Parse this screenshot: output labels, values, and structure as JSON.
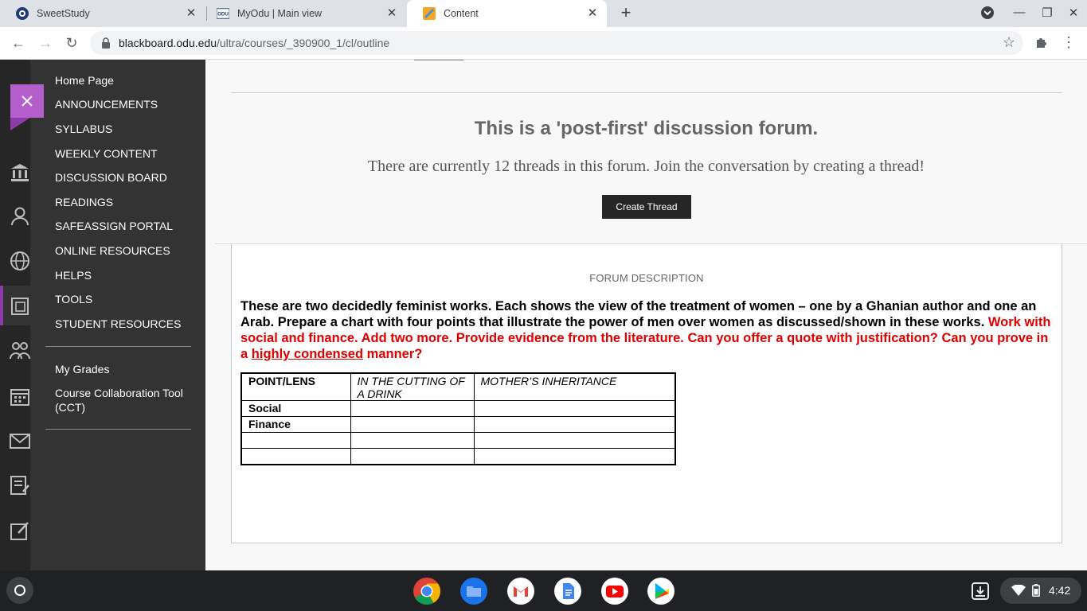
{
  "browser": {
    "tabs": [
      {
        "title": "SweetStudy",
        "favicon": "sweetstudy-logo-icon",
        "active": false
      },
      {
        "title": "MyOdu | Main view",
        "favicon": "odu-logo-icon",
        "active": false
      },
      {
        "title": "Content",
        "favicon": "blackboard-content-icon",
        "active": true
      }
    ],
    "url_host": "blackboard.odu.edu",
    "url_path": "/ultra/courses/_390900_1/cl/outline"
  },
  "course_menu": {
    "items": [
      {
        "label": "Home Page"
      },
      {
        "label": "ANNOUNCEMENTS"
      },
      {
        "label": "SYLLABUS"
      },
      {
        "label": "WEEKLY CONTENT"
      },
      {
        "label": "DISCUSSION BOARD"
      },
      {
        "label": "READINGS"
      },
      {
        "label": "SAFEASSIGN PORTAL"
      },
      {
        "label": "ONLINE RESOURCES"
      },
      {
        "label": "HELPS"
      },
      {
        "label": "TOOLS"
      },
      {
        "label": "STUDENT RESOURCES"
      }
    ],
    "secondary_items": [
      {
        "label": "My Grades"
      },
      {
        "label": "Course Collaboration Tool (CCT)"
      }
    ]
  },
  "forum": {
    "title": "This is a 'post-first' discussion forum.",
    "subtitle": "There are currently 12 threads in this forum. Join the conversation by creating a thread!",
    "create_button": "Create Thread",
    "description_label": "FORUM DESCRIPTION",
    "description_black": "These are two decidedly feminist works.  Each shows the view of the treatment of women – one by a Ghanian author and one an Arab. Prepare a chart with four points that illustrate the power of men over women as discussed/shown in these works.",
    "description_red_1": "Work with social and finance.  Add two more. Provide evidence from the literature. Can you offer a quote with justification? Can you prove in a",
    "description_red_underlined": "highly condensed",
    "description_red_2": "manner?"
  },
  "lens_table": {
    "headers": [
      "POINT/LENS",
      "IN THE CUTTING OF A DRINK",
      "MOTHER’S INHERITANCE"
    ],
    "rows": [
      [
        "Social",
        "",
        ""
      ],
      [
        "Finance",
        "",
        ""
      ],
      [
        "",
        "",
        ""
      ],
      [
        "",
        "",
        ""
      ]
    ]
  },
  "shelf": {
    "apps": [
      "chrome-icon",
      "files-icon",
      "gmail-icon",
      "docs-icon",
      "youtube-icon",
      "play-store-icon"
    ],
    "time": "4:42"
  },
  "colors": {
    "menu_bg": "#333333",
    "rail_bg": "#262626",
    "accent_purple": "#b45ecc",
    "instruction_red": "#e00000"
  }
}
